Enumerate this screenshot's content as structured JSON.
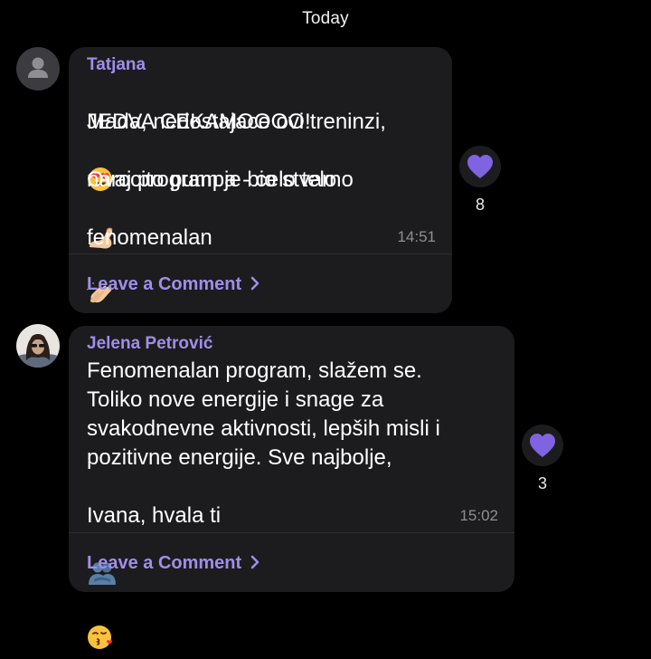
{
  "date_separator": "Today",
  "posts": [
    {
      "sender": "Tatjana",
      "message_lines": [
        "JEDVA CEKAMOOOO!",
        "Mada, nedostajace ovi treninzi,",
        "narocito pumpa - celo telo",
        "Ovaj program je bio stvarno",
        "fenomenalan"
      ],
      "time": "14:51",
      "comment_label": "Leave a Comment",
      "reaction_count": "8",
      "emojis": [
        "heart-eyes-emoji",
        "flexed-biceps-emoji",
        "clapping-hands-emoji"
      ]
    },
    {
      "sender": "Jelena Petrović",
      "message_lines": [
        "Fenomenalan program, slažem se.",
        "Toliko nove energije i snage za",
        "svakodnevne aktivnosti, lepših misli i",
        "pozitivne energije. Sve najbolje,",
        "Ivana, hvala ti"
      ],
      "time": "15:02",
      "comment_label": "Leave a Comment",
      "reaction_count": "3",
      "emojis": [
        "people-hugging-emoji",
        "face-blowing-kiss-emoji"
      ]
    }
  ],
  "colors": {
    "accent": "#a08ee8",
    "heart": "#7f63e0",
    "bubble": "#1c1c1e",
    "time": "#8e8e93"
  },
  "icons": {
    "avatar_placeholder": "person-silhouette-icon",
    "reaction": "heart-icon",
    "chevron": "chevron-right-icon"
  }
}
